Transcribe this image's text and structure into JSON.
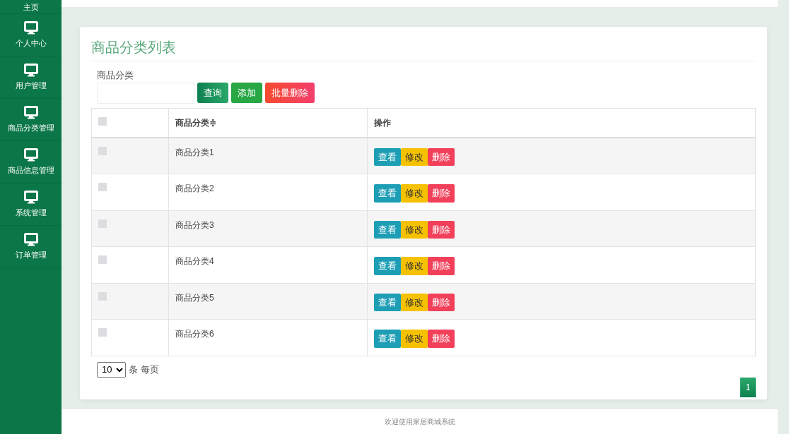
{
  "sidebar": {
    "items": [
      {
        "label": "主页",
        "icon": false
      },
      {
        "label": "个人中心",
        "icon": true
      },
      {
        "label": "用户管理",
        "icon": true
      },
      {
        "label": "商品分类管理",
        "icon": true
      },
      {
        "label": "商品信息管理",
        "icon": true
      },
      {
        "label": "系统管理",
        "icon": true
      },
      {
        "label": "订单管理",
        "icon": true
      }
    ]
  },
  "page_title": "商品分类列表",
  "search": {
    "label": "商品分类",
    "buttons": [
      {
        "label": "查询",
        "kind": "query"
      },
      {
        "label": "添加",
        "kind": "add"
      },
      {
        "label": "批量删除",
        "kind": "delete"
      }
    ]
  },
  "table": {
    "select_all": {
      "checked": false
    },
    "columns": [
      "商品分类≑",
      "操作"
    ],
    "rows": [
      {
        "checked": false,
        "name": "商品分类1",
        "actions": [
          {
            "label": "查看",
            "kind": "view"
          },
          {
            "label": "修改",
            "kind": "edit"
          },
          {
            "label": "删除",
            "kind": "delete"
          }
        ]
      },
      {
        "checked": false,
        "name": "商品分类2",
        "actions": [
          {
            "label": "查看",
            "kind": "view"
          },
          {
            "label": "修改",
            "kind": "edit"
          },
          {
            "label": "删除",
            "kind": "delete"
          }
        ]
      },
      {
        "checked": false,
        "name": "商品分类3",
        "actions": [
          {
            "label": "查看",
            "kind": "view"
          },
          {
            "label": "修改",
            "kind": "edit"
          },
          {
            "label": "删除",
            "kind": "delete"
          }
        ]
      },
      {
        "checked": false,
        "name": "商品分类4",
        "actions": [
          {
            "label": "查看",
            "kind": "view"
          },
          {
            "label": "修改",
            "kind": "edit"
          },
          {
            "label": "删除",
            "kind": "delete"
          }
        ]
      },
      {
        "checked": false,
        "name": "商品分类5",
        "actions": [
          {
            "label": "查看",
            "kind": "view"
          },
          {
            "label": "修改",
            "kind": "edit"
          },
          {
            "label": "删除",
            "kind": "delete"
          }
        ]
      },
      {
        "checked": false,
        "name": "商品分类6",
        "actions": [
          {
            "label": "查看",
            "kind": "view"
          },
          {
            "label": "修改",
            "kind": "edit"
          },
          {
            "label": "删除",
            "kind": "delete"
          }
        ]
      }
    ]
  },
  "page_size": {
    "value": "10",
    "label": "条 每页"
  },
  "pagination": [
    {
      "label": "1",
      "selected": true
    }
  ],
  "footer": "欢迎使用家居商城系统"
}
